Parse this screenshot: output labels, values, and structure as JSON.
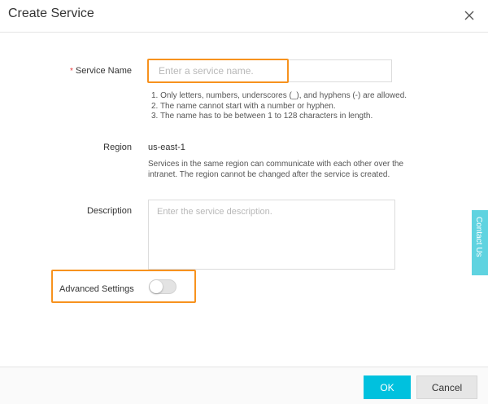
{
  "dialog": {
    "title": "Create Service",
    "close_icon": "close-icon"
  },
  "form": {
    "service_name": {
      "required_mark": "*",
      "label": "Service Name",
      "placeholder": "Enter a service name.",
      "value": "",
      "hints": [
        "1. Only letters, numbers, underscores (_), and hyphens (-) are allowed.",
        "2. The name cannot start with a number or hyphen.",
        "3. The name has to be between 1 to 128 characters in length."
      ]
    },
    "region": {
      "label": "Region",
      "value": "us-east-1",
      "hint_line1": "Services in the same region can communicate with each other over the",
      "hint_line2": "intranet. The region cannot be changed after the service is created."
    },
    "description": {
      "label": "Description",
      "placeholder": "Enter the service description.",
      "value": ""
    },
    "advanced_settings": {
      "label": "Advanced Settings",
      "enabled": false
    }
  },
  "contact_tab": {
    "label": "Contact Us"
  },
  "footer": {
    "ok_label": "OK",
    "cancel_label": "Cancel"
  },
  "colors": {
    "highlight": "#f7921e",
    "primary_button": "#00c1de",
    "contact_tab": "#5fd3e0",
    "required": "#e4393c"
  }
}
